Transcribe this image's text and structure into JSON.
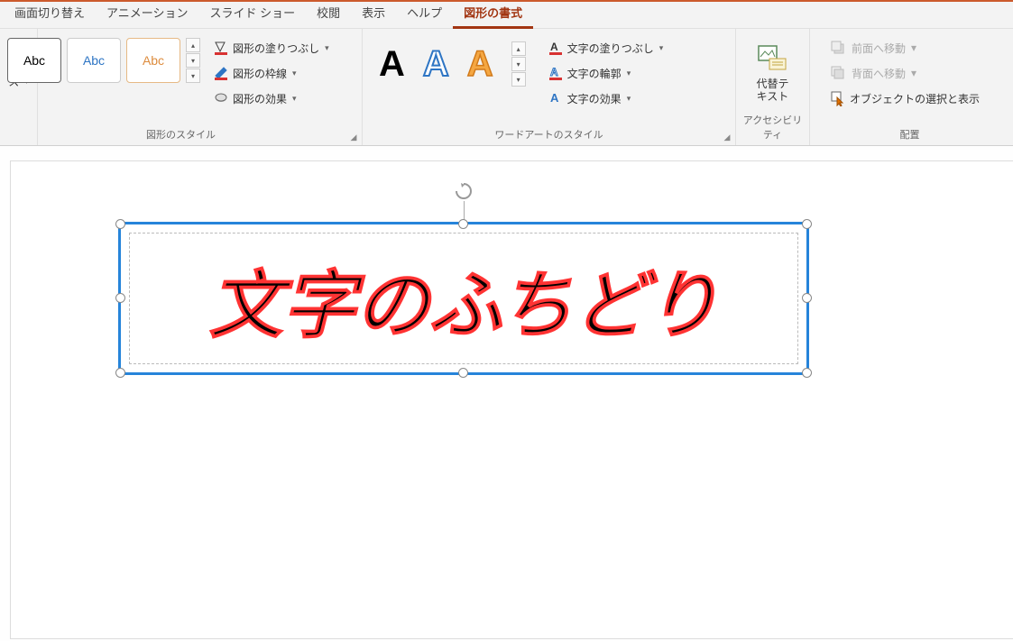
{
  "tabs": {
    "items": [
      {
        "label": "画面切り替え"
      },
      {
        "label": "アニメーション"
      },
      {
        "label": "スライド ショー"
      },
      {
        "label": "校閲"
      },
      {
        "label": "表示"
      },
      {
        "label": "ヘルプ"
      },
      {
        "label": "図形の書式",
        "active": true
      }
    ]
  },
  "ribbon": {
    "left_slice_label": "ス",
    "shape_styles": {
      "thumb_label": "Abc",
      "fill": "図形の塗りつぶし",
      "outline": "図形の枠線",
      "effects": "図形の効果",
      "group_label": "図形のスタイル"
    },
    "wordart": {
      "letter": "A",
      "text_fill": "文字の塗りつぶし",
      "text_outline": "文字の輪郭",
      "text_effects": "文字の効果",
      "group_label": "ワードアートのスタイル"
    },
    "accessibility": {
      "btn": "代替テ\nキスト",
      "group_label": "アクセシビリティ"
    },
    "arrange": {
      "bring_forward": "前面へ移動",
      "send_backward": "背面へ移動",
      "selection_pane": "オブジェクトの選択と表示",
      "group_label": "配置"
    }
  },
  "canvas": {
    "textbox_content": "文字のふちどり"
  }
}
